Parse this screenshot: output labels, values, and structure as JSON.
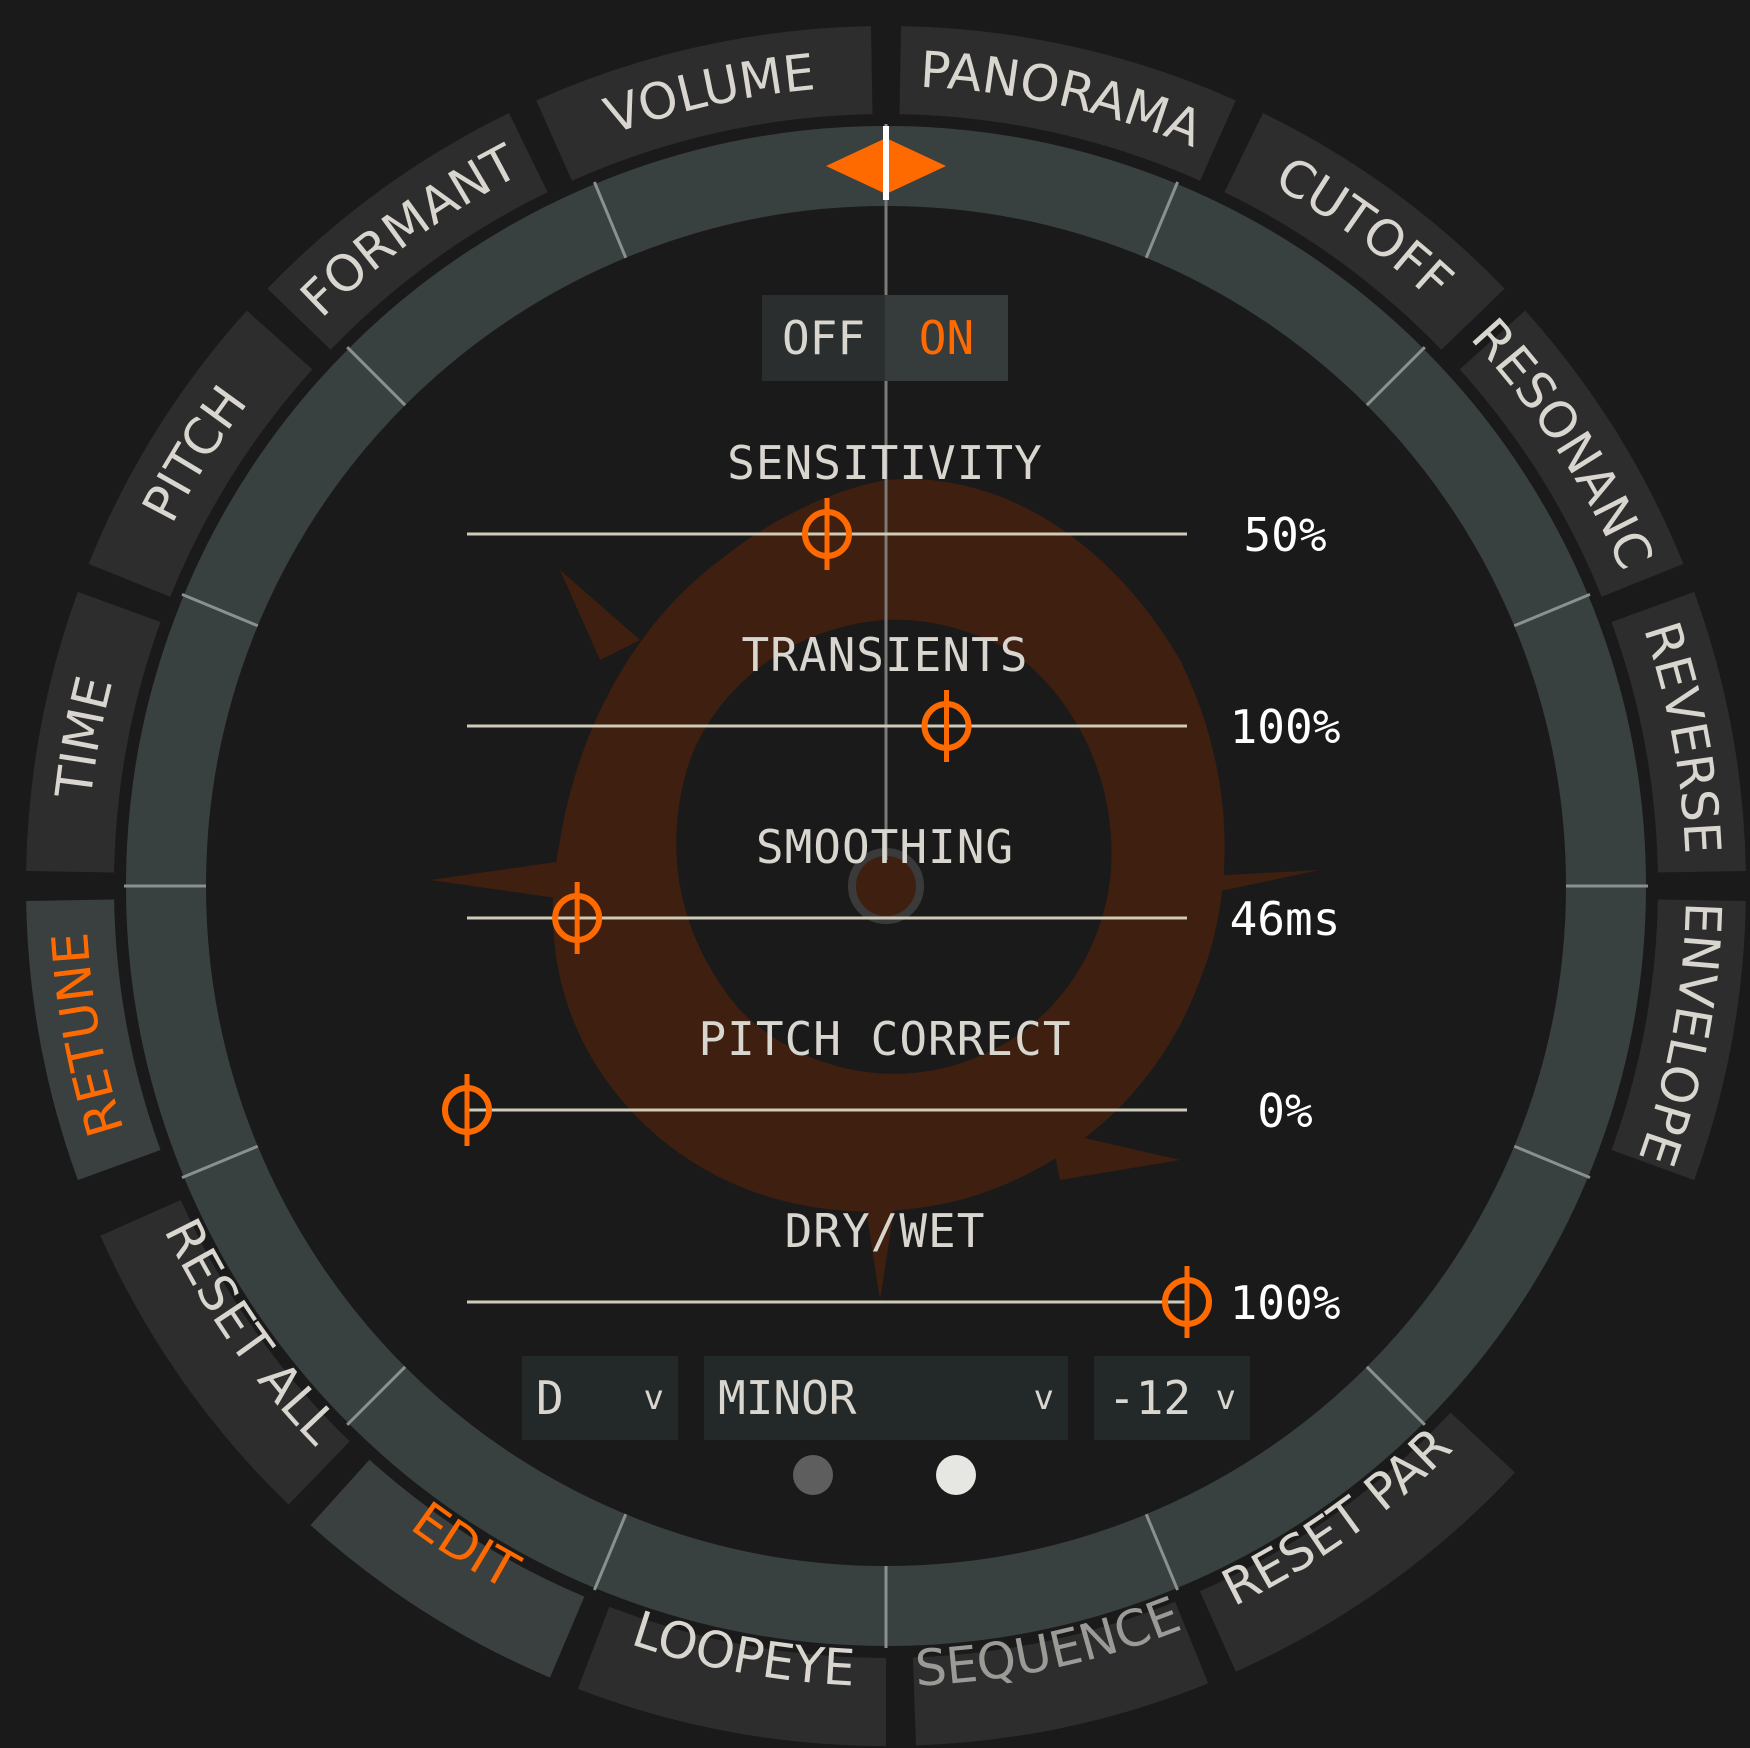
{
  "ring": {
    "top_segments": [
      "FORMANT",
      "VOLUME",
      "PANORAMA",
      "CUTOFF"
    ],
    "left_segments": [
      "TIME",
      "PITCH"
    ],
    "right_segments": [
      "RESONANCE",
      "REVERSE",
      "ENVELOPE"
    ],
    "active_left": "RETUNE",
    "bottom_segments": [
      "RESET ALL",
      "EDIT",
      "LOOPEYE",
      "SEQUENCE",
      "RESET PAR"
    ],
    "active_bottom": "EDIT",
    "dim_segment": "SEQUENCE"
  },
  "toggle": {
    "off_label": "OFF",
    "on_label": "ON",
    "state": "ON"
  },
  "params": [
    {
      "label": "SENSITIVITY",
      "value": "50%",
      "fraction": 0.5
    },
    {
      "label": "TRANSIENTS",
      "value": "100%",
      "fraction": 0.666
    },
    {
      "label": "SMOOTHING",
      "value": "46ms",
      "fraction": 0.153
    },
    {
      "label": "PITCH CORRECT",
      "value": "0%",
      "fraction": 0.0
    },
    {
      "label": "DRY/WET",
      "value": "100%",
      "fraction": 1.0
    }
  ],
  "dropdowns": {
    "key": "D",
    "scale": "MINOR",
    "octave": "-12",
    "chevron": "v"
  },
  "pages": {
    "count": 2,
    "current": 2
  },
  "colors": {
    "accent": "#ff6a00",
    "ring": "#394040",
    "waveform": "#3f1f10",
    "text": "#d8d6cf"
  },
  "icons": {
    "playhead": "diamond-marker-icon",
    "center": "center-dot-icon",
    "chevron": "chevron-down-icon"
  }
}
